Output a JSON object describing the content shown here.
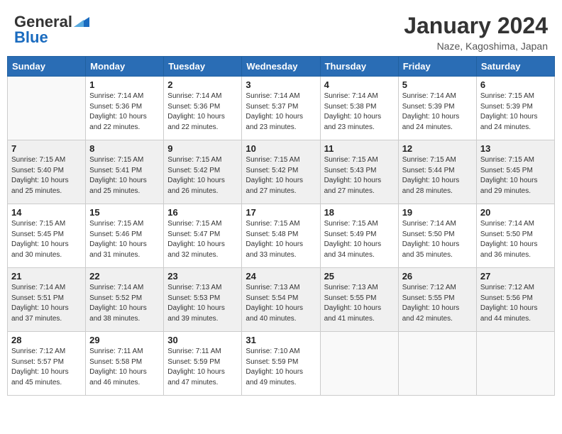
{
  "header": {
    "logo_line1": "General",
    "logo_line2": "Blue",
    "month_title": "January 2024",
    "location": "Naze, Kagoshima, Japan"
  },
  "weekdays": [
    "Sunday",
    "Monday",
    "Tuesday",
    "Wednesday",
    "Thursday",
    "Friday",
    "Saturday"
  ],
  "weeks": [
    [
      {
        "day": "",
        "info": ""
      },
      {
        "day": "1",
        "info": "Sunrise: 7:14 AM\nSunset: 5:36 PM\nDaylight: 10 hours\nand 22 minutes."
      },
      {
        "day": "2",
        "info": "Sunrise: 7:14 AM\nSunset: 5:36 PM\nDaylight: 10 hours\nand 22 minutes."
      },
      {
        "day": "3",
        "info": "Sunrise: 7:14 AM\nSunset: 5:37 PM\nDaylight: 10 hours\nand 23 minutes."
      },
      {
        "day": "4",
        "info": "Sunrise: 7:14 AM\nSunset: 5:38 PM\nDaylight: 10 hours\nand 23 minutes."
      },
      {
        "day": "5",
        "info": "Sunrise: 7:14 AM\nSunset: 5:39 PM\nDaylight: 10 hours\nand 24 minutes."
      },
      {
        "day": "6",
        "info": "Sunrise: 7:15 AM\nSunset: 5:39 PM\nDaylight: 10 hours\nand 24 minutes."
      }
    ],
    [
      {
        "day": "7",
        "info": "Sunrise: 7:15 AM\nSunset: 5:40 PM\nDaylight: 10 hours\nand 25 minutes."
      },
      {
        "day": "8",
        "info": "Sunrise: 7:15 AM\nSunset: 5:41 PM\nDaylight: 10 hours\nand 25 minutes."
      },
      {
        "day": "9",
        "info": "Sunrise: 7:15 AM\nSunset: 5:42 PM\nDaylight: 10 hours\nand 26 minutes."
      },
      {
        "day": "10",
        "info": "Sunrise: 7:15 AM\nSunset: 5:42 PM\nDaylight: 10 hours\nand 27 minutes."
      },
      {
        "day": "11",
        "info": "Sunrise: 7:15 AM\nSunset: 5:43 PM\nDaylight: 10 hours\nand 27 minutes."
      },
      {
        "day": "12",
        "info": "Sunrise: 7:15 AM\nSunset: 5:44 PM\nDaylight: 10 hours\nand 28 minutes."
      },
      {
        "day": "13",
        "info": "Sunrise: 7:15 AM\nSunset: 5:45 PM\nDaylight: 10 hours\nand 29 minutes."
      }
    ],
    [
      {
        "day": "14",
        "info": "Sunrise: 7:15 AM\nSunset: 5:45 PM\nDaylight: 10 hours\nand 30 minutes."
      },
      {
        "day": "15",
        "info": "Sunrise: 7:15 AM\nSunset: 5:46 PM\nDaylight: 10 hours\nand 31 minutes."
      },
      {
        "day": "16",
        "info": "Sunrise: 7:15 AM\nSunset: 5:47 PM\nDaylight: 10 hours\nand 32 minutes."
      },
      {
        "day": "17",
        "info": "Sunrise: 7:15 AM\nSunset: 5:48 PM\nDaylight: 10 hours\nand 33 minutes."
      },
      {
        "day": "18",
        "info": "Sunrise: 7:15 AM\nSunset: 5:49 PM\nDaylight: 10 hours\nand 34 minutes."
      },
      {
        "day": "19",
        "info": "Sunrise: 7:14 AM\nSunset: 5:50 PM\nDaylight: 10 hours\nand 35 minutes."
      },
      {
        "day": "20",
        "info": "Sunrise: 7:14 AM\nSunset: 5:50 PM\nDaylight: 10 hours\nand 36 minutes."
      }
    ],
    [
      {
        "day": "21",
        "info": "Sunrise: 7:14 AM\nSunset: 5:51 PM\nDaylight: 10 hours\nand 37 minutes."
      },
      {
        "day": "22",
        "info": "Sunrise: 7:14 AM\nSunset: 5:52 PM\nDaylight: 10 hours\nand 38 minutes."
      },
      {
        "day": "23",
        "info": "Sunrise: 7:13 AM\nSunset: 5:53 PM\nDaylight: 10 hours\nand 39 minutes."
      },
      {
        "day": "24",
        "info": "Sunrise: 7:13 AM\nSunset: 5:54 PM\nDaylight: 10 hours\nand 40 minutes."
      },
      {
        "day": "25",
        "info": "Sunrise: 7:13 AM\nSunset: 5:55 PM\nDaylight: 10 hours\nand 41 minutes."
      },
      {
        "day": "26",
        "info": "Sunrise: 7:12 AM\nSunset: 5:55 PM\nDaylight: 10 hours\nand 42 minutes."
      },
      {
        "day": "27",
        "info": "Sunrise: 7:12 AM\nSunset: 5:56 PM\nDaylight: 10 hours\nand 44 minutes."
      }
    ],
    [
      {
        "day": "28",
        "info": "Sunrise: 7:12 AM\nSunset: 5:57 PM\nDaylight: 10 hours\nand 45 minutes."
      },
      {
        "day": "29",
        "info": "Sunrise: 7:11 AM\nSunset: 5:58 PM\nDaylight: 10 hours\nand 46 minutes."
      },
      {
        "day": "30",
        "info": "Sunrise: 7:11 AM\nSunset: 5:59 PM\nDaylight: 10 hours\nand 47 minutes."
      },
      {
        "day": "31",
        "info": "Sunrise: 7:10 AM\nSunset: 5:59 PM\nDaylight: 10 hours\nand 49 minutes."
      },
      {
        "day": "",
        "info": ""
      },
      {
        "day": "",
        "info": ""
      },
      {
        "day": "",
        "info": ""
      }
    ]
  ]
}
